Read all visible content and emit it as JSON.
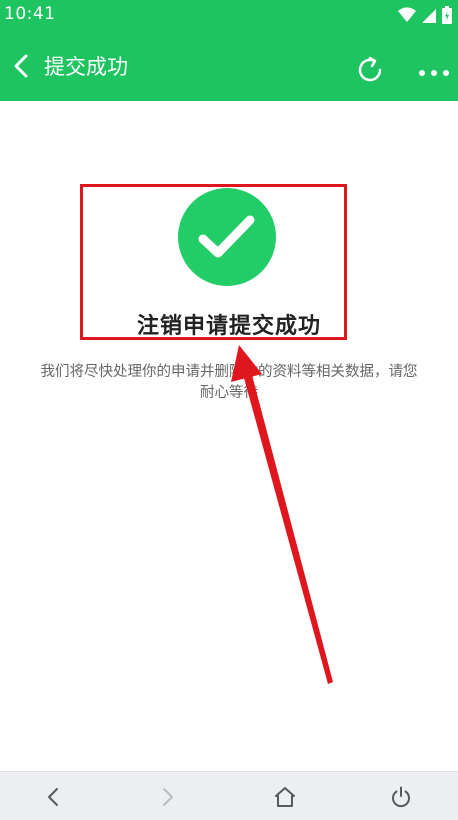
{
  "status_bar": {
    "time": "10:41",
    "icons": [
      "wifi-icon",
      "signal-icon",
      "battery-icon"
    ]
  },
  "app_bar": {
    "title": "提交成功",
    "background_color": "#1dc45f",
    "left_icon": "back-arrow-icon",
    "right_icons": [
      "refresh-icon",
      "more-options-icon"
    ]
  },
  "result": {
    "icon": "checkmark-circle-icon",
    "icon_color": "#22cc66",
    "title": "注销申请提交成功",
    "description_line1": "我们将尽快处理你的申请并删除你的资料等相关数据，请您",
    "description_line2": "耐心等待"
  },
  "annotation": {
    "highlight_color": "#e0161e",
    "arrow_color": "#e0161e"
  },
  "nav_bar": {
    "buttons": [
      "back-icon",
      "forward-icon",
      "home-icon",
      "power-icon"
    ]
  }
}
